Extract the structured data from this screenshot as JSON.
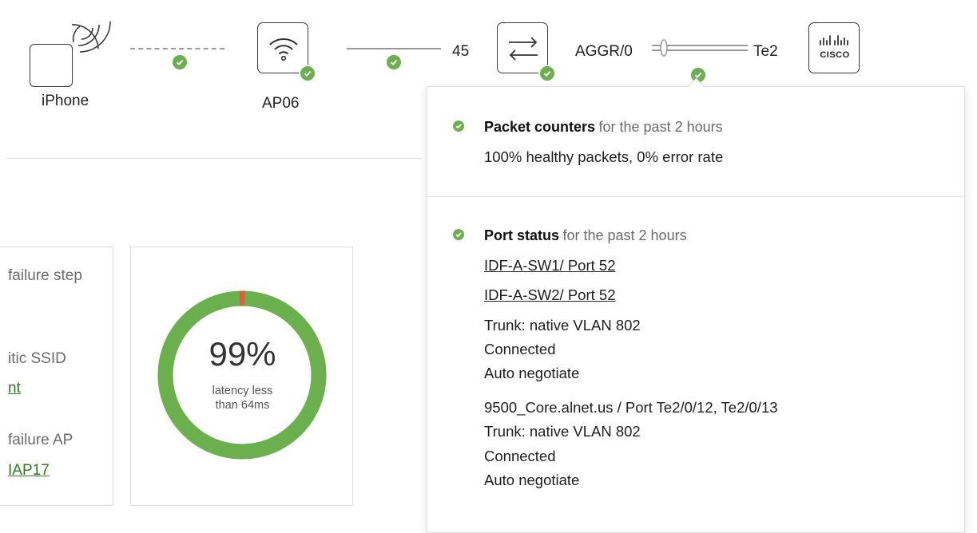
{
  "topology": {
    "client": {
      "label": "iPhone",
      "icon": "iphone-icon"
    },
    "ap": {
      "label": "AP06",
      "icon": "wifi-icon"
    },
    "port_in": "45",
    "switch": {
      "icon": "switch-arrows-icon"
    },
    "aggr_label": "AGGR/0",
    "port_out": "Te2",
    "router": {
      "icon": "cisco-logo-icon",
      "logo_text": "CISCO"
    },
    "status_color": "#6ab04c"
  },
  "left_card": {
    "item1_label": "failure step",
    "item2_label": "itic SSID",
    "item2_link": "nt",
    "item3_label": "failure AP",
    "item3_link": "IAP17"
  },
  "donut_card": {
    "value_text": "99%",
    "caption_line1": "latency less",
    "caption_line2": "than 64ms",
    "healthy_fraction": 0.99,
    "healthy_color": "#6ab04c",
    "error_color": "#e35a3c"
  },
  "popover": {
    "packet": {
      "title": "Packet counters",
      "subtitle": "for the past 2 hours",
      "detail": "100% healthy packets, 0% error rate"
    },
    "port": {
      "title": "Port status",
      "subtitle": "for the past 2 hours",
      "link1": "IDF-A-SW1/ Port 52",
      "link2": "IDF-A-SW2/ Port 52",
      "group1": [
        "Trunk: native VLAN 802",
        "Connected",
        "Auto negotiate"
      ],
      "core_line": "9500_Core.alnet.us / Port Te2/0/12, Te2/0/13",
      "group2": [
        "Trunk: native VLAN 802",
        "Connected",
        "Auto negotiate"
      ]
    }
  }
}
